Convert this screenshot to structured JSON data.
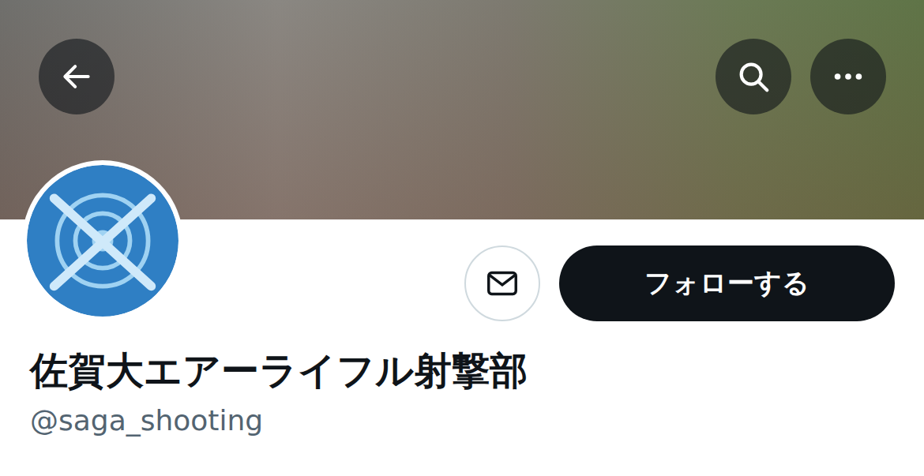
{
  "profile": {
    "name": "佐賀大エアーライフル射撃部",
    "handle": "@saga_shooting",
    "following": false
  },
  "actions": {
    "follow_label": "フォローする"
  }
}
